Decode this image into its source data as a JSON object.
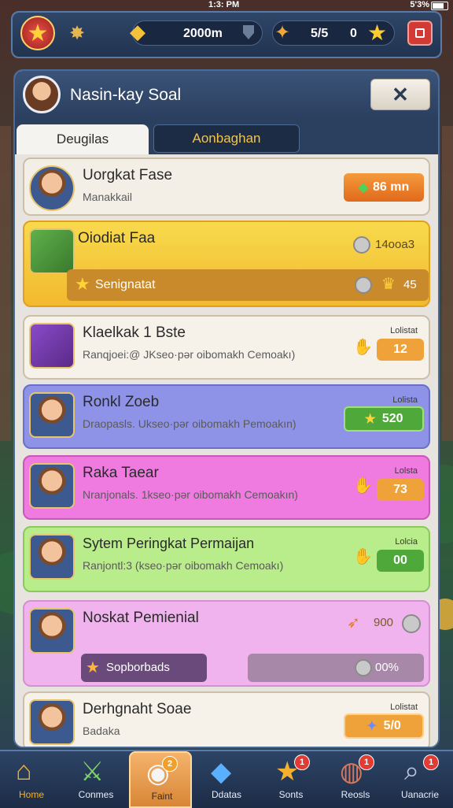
{
  "status": {
    "time": "1:3: PM",
    "right": "5'3%"
  },
  "topbar": {
    "coins": "2000m",
    "gem_value": "5/5",
    "score": "0"
  },
  "panel": {
    "title": "Nasin-kay Soal",
    "close_label": "✕",
    "tabs": [
      {
        "label": "Deugilas"
      },
      {
        "label": "Aonbaghan"
      }
    ]
  },
  "rows": [
    {
      "title": "Uorgkat Fase",
      "subtitle": "Manakkail",
      "value": "86 mn"
    },
    {
      "title": "Oiodiat Faa",
      "value": "14ooa3",
      "sub_label": "Senignatat",
      "sub_value": "45"
    },
    {
      "title": "Klaelkak 1 Bste",
      "subtitle": "Ranqjoei:@ JKseo·pər oibomakh Cemoakı)",
      "corner": "Lolistat",
      "value": "12"
    },
    {
      "title": "Ronkl Zoeb",
      "subtitle": "Draopasls. Ukseo·pər oibomakh Pemoakın)",
      "corner": "Lolista",
      "value": "520"
    },
    {
      "title": "Raka Taear",
      "subtitle": "Nranjonals. 1kseo·pər oibomakh Cemoakın)",
      "corner": "Lolsta",
      "value": "73"
    },
    {
      "title": "Sytem Peringkat Permaijan",
      "subtitle": "Ranjontl:3 (kseo·pər oibomakh Cemoakı)",
      "corner": "Lolcia",
      "value": "00"
    },
    {
      "title": "Noskat Pemienial",
      "value": "900",
      "sub_label": "Sopborbads",
      "sub_value": "00%"
    },
    {
      "title": "Derhgnaht Soae",
      "subtitle": "Badaka",
      "corner": "Lolistat",
      "value": "5/0"
    }
  ],
  "nav": [
    {
      "label": "Home"
    },
    {
      "label": "Conmes"
    },
    {
      "label": "Faint",
      "badge": "2"
    },
    {
      "label": "Ddatas"
    },
    {
      "label": "Sonts",
      "badge": "1"
    },
    {
      "label": "Reosls",
      "badge": "1"
    },
    {
      "label": "Uanacrie",
      "badge": "1"
    }
  ],
  "colors": {
    "accent": "#f0852d",
    "panel_header": "#2b3f5f",
    "row_yellow": "#f5c93a",
    "row_blue": "#8e93e8",
    "row_pink": "#f07be0",
    "row_green": "#b9ec8a",
    "row_lilac": "#f1b3ee"
  }
}
